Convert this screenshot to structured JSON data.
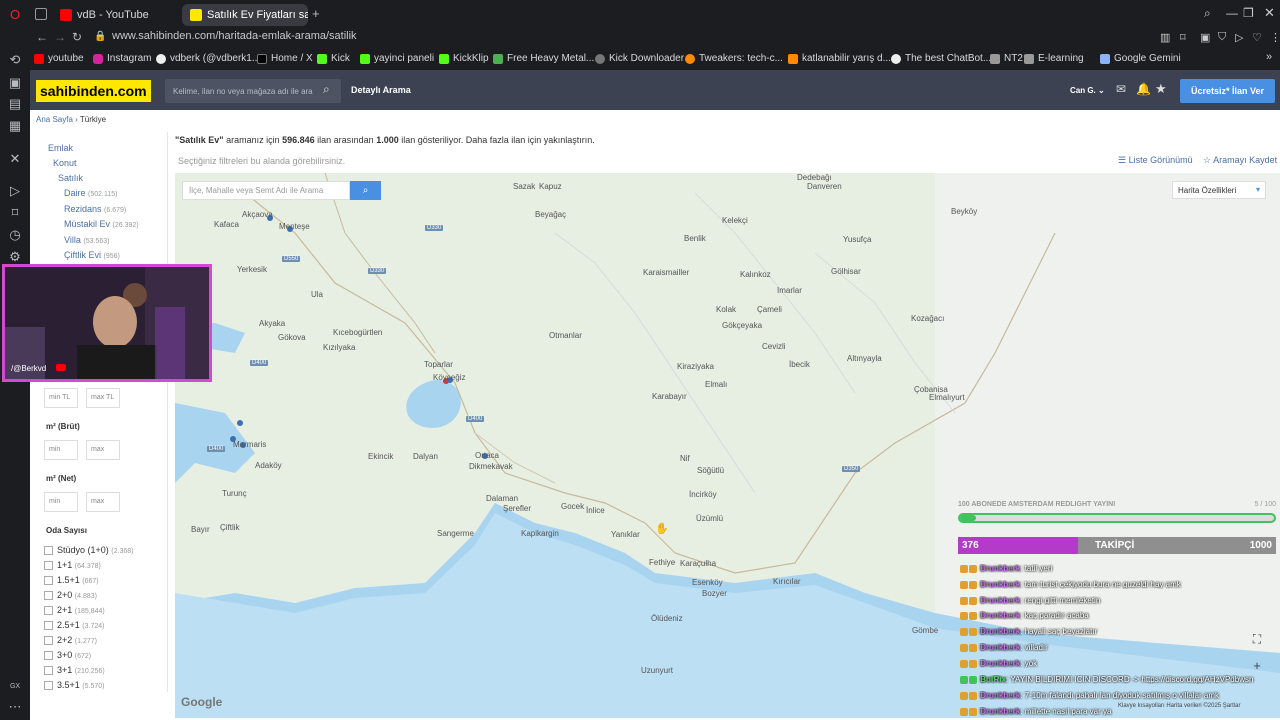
{
  "browser": {
    "tabs": [
      {
        "label": "vdB - YouTube",
        "favicon_color": "#ff0000"
      },
      {
        "label": "Satılık Ev Fiyatları sahibind",
        "favicon_color": "#ffe800"
      }
    ],
    "new_tab": "+",
    "url": "www.sahibinden.com/haritada-emlak-arama/satilik",
    "bookmarks": [
      "youtube",
      "Instagram",
      "vdberk (@vdberk1...",
      "Home / X",
      "Kick",
      "yayinci paneli",
      "KickKlip",
      "Free Heavy Metal...",
      "Kick Downloader",
      "Tweakers: tech-c...",
      "katlanabilir yarış d...",
      "The best ChatBot...",
      "NT2",
      "E-learning",
      "Google Gemini"
    ]
  },
  "header": {
    "logo": "sahibinden.com",
    "search_placeholder": "Kelime, ilan no veya mağaza adı ile ara",
    "detailed_search": "Detaylı Arama",
    "user": "Can G.",
    "post_ad": "Ücretsiz* İlan Ver"
  },
  "breadcrumb": {
    "home": "Ana Sayfa",
    "current": "Türkiye"
  },
  "results": {
    "query": "\"Satılık Ev\"",
    "text1": " aramanız için ",
    "total": "596.846",
    "text2": " ilan arasından ",
    "shown": "1.000",
    "text3": " ilan gösteriliyor. Daha fazla ilan için yakınlaştırın.",
    "hint": "Seçtiğiniz filtreleri bu alanda görebilirsiniz.",
    "list_view": "Liste Görünümü",
    "save_search": "Aramayı Kaydet"
  },
  "filters": {
    "emlak": "Emlak",
    "konut": "Konut",
    "satilik": "Satılık",
    "types": [
      {
        "label": "Daire",
        "count": "(502.115)"
      },
      {
        "label": "Rezidans",
        "count": "(6.679)"
      },
      {
        "label": "Müstakil Ev",
        "count": "(26.392)"
      },
      {
        "label": "Villa",
        "count": "(53.563)"
      },
      {
        "label": "Çiftlik Evi",
        "count": "(956)"
      }
    ],
    "price_min": "min TL",
    "price_max": "max TL",
    "m2_brut": "m² (Brüt)",
    "m2_net": "m² (Net)",
    "min": "min",
    "max": "max",
    "rooms_title": "Oda Sayısı",
    "rooms": [
      {
        "label": "Stüdyo (1+0)",
        "count": "(2.368)"
      },
      {
        "label": "1+1",
        "count": "(64.378)"
      },
      {
        "label": "1.5+1",
        "count": "(667)"
      },
      {
        "label": "2+0",
        "count": "(4.883)"
      },
      {
        "label": "2+1",
        "count": "(185.844)"
      },
      {
        "label": "2.5+1",
        "count": "(3.724)"
      },
      {
        "label": "2+2",
        "count": "(1.277)"
      },
      {
        "label": "3+0",
        "count": "(672)"
      },
      {
        "label": "3+1",
        "count": "(210.256)"
      },
      {
        "label": "3.5+1",
        "count": "(5.570)"
      }
    ]
  },
  "map": {
    "search_placeholder": "İlçe, Mahalle veya Semt  Adı ile Arama",
    "features": "Harita Özellikleri",
    "google": "Google",
    "places": [
      "Sazak",
      "Kapuz",
      "Dedebağı",
      "Danveren",
      "Akçaova",
      "Kafaca",
      "Menteşe",
      "Beyağaç",
      "Kelekçi",
      "Benlik",
      "Yerkesik",
      "Ula",
      "Akyaka",
      "Gökova",
      "Kıcebogürtlen",
      "Kızılyaka",
      "Otmanlar",
      "Toparlar",
      "Köyceğiz",
      "Ortaca",
      "Dikmekavak",
      "Karaismailler",
      "Kalınkoz",
      "Imarlar",
      "Çameli",
      "Kolak",
      "Gökçeyaka",
      "Cevizli",
      "Kiraziyaka",
      "Elmalı",
      "İbecik",
      "Karabayır",
      "Marmaris",
      "Adaköy",
      "Turunç",
      "Ekincik",
      "Dalyan",
      "Dalaman",
      "Şerefler",
      "Gocek",
      "İnlice",
      "Nif",
      "Söğütlü",
      "İncirköy",
      "Üzümlü",
      "Bayır",
      "Çiftlik",
      "Sangerme",
      "Kapikargin",
      "Yanıklar",
      "Fethiye",
      "Karaçulha",
      "Esenköy",
      "Kırıcılar",
      "Bozyer",
      "Ölüdeniz",
      "Yusufça",
      "Beyköy",
      "Gölhisar",
      "Kozağacı",
      "Altınyayla",
      "Çobanisa",
      "Elmalıyurt",
      "Uzunyurt",
      "Gömbe"
    ],
    "attribution": "Klavye kısayolları   Harita verileri ©2025   Şartlar"
  },
  "webcam": {
    "handle": "/@Berkvd"
  },
  "stream": {
    "goal_title": "100 ABONEDE AMSTERDAM REDLIGHT YAYINI",
    "goal_progress": "5 / 100",
    "goal_fraction": 0.05,
    "followers_current": "376",
    "followers_label": "TAKİPÇİ",
    "followers_target": "1000",
    "followers_fraction": 0.376,
    "chat": [
      {
        "user": "Drunkberk",
        "msg": ": tatil yeri",
        "bot": false
      },
      {
        "user": "Drunkberk",
        "msg": ": tam turist çekiyodu bura ne guzeldi hay amk",
        "bot": false
      },
      {
        "user": "Drunkberk",
        "msg": ": rengi gitti memleketin",
        "bot": false
      },
      {
        "user": "Drunkberk",
        "msg": ": kaç paradır acaba",
        "bot": false
      },
      {
        "user": "Drunkberk",
        "msg": ": hayali saç beyazlatır",
        "bot": false
      },
      {
        "user": "Drunkberk",
        "msg": ": villadır",
        "bot": false
      },
      {
        "user": "Drunkberk",
        "msg": ": yok",
        "bot": false
      },
      {
        "user": "BotRix",
        "msg": ": YAYIN BILDIRIMI ICIN DISCORD -> https://discord.gg/AHzVPdbwsn",
        "bot": true
      },
      {
        "user": "Drunkberk",
        "msg": ": 7-10m falandı pahalı lan diyoduk satılmış o villalar amk",
        "bot": false
      },
      {
        "user": "Drunkberk",
        "msg": ": millette nasıl para var ya",
        "bot": false
      }
    ]
  }
}
